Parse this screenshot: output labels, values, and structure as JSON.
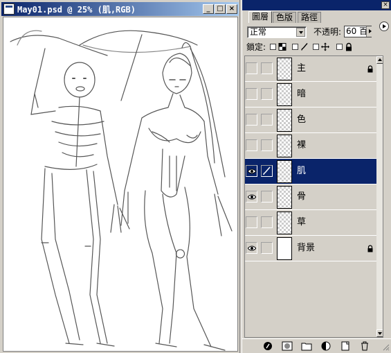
{
  "document": {
    "title": "May01.psd @ 25% (肌,RGB)"
  },
  "layers_panel": {
    "tabs": [
      {
        "label": "圖層",
        "active": true
      },
      {
        "label": "色版",
        "active": false
      },
      {
        "label": "路徑",
        "active": false
      }
    ],
    "blend_mode": "正常",
    "opacity_label": "不透明:",
    "opacity_value": "60 百",
    "lock_label": "鎖定:",
    "layers": [
      {
        "name": "主",
        "visible": false,
        "locked": true,
        "selected": false,
        "thumb": "transparent"
      },
      {
        "name": "暗",
        "visible": false,
        "locked": false,
        "selected": false,
        "thumb": "transparent"
      },
      {
        "name": "色",
        "visible": false,
        "locked": false,
        "selected": false,
        "thumb": "transparent"
      },
      {
        "name": "裸",
        "visible": false,
        "locked": false,
        "selected": false,
        "thumb": "transparent"
      },
      {
        "name": "肌",
        "visible": true,
        "locked": false,
        "selected": true,
        "thumb": "transparent"
      },
      {
        "name": "骨",
        "visible": true,
        "locked": false,
        "selected": false,
        "thumb": "transparent"
      },
      {
        "name": "草",
        "visible": false,
        "locked": false,
        "selected": false,
        "thumb": "transparent"
      },
      {
        "name": "背景",
        "visible": true,
        "locked": true,
        "selected": false,
        "thumb": "solid"
      }
    ],
    "toolbar_icons": [
      "add-layer-style-icon",
      "add-mask-icon",
      "new-set-icon",
      "new-adjustment-layer-icon",
      "new-layer-icon",
      "delete-layer-icon"
    ]
  },
  "colors": {
    "selection": "#0a246a",
    "panel_bg": "#d4d0c8"
  }
}
